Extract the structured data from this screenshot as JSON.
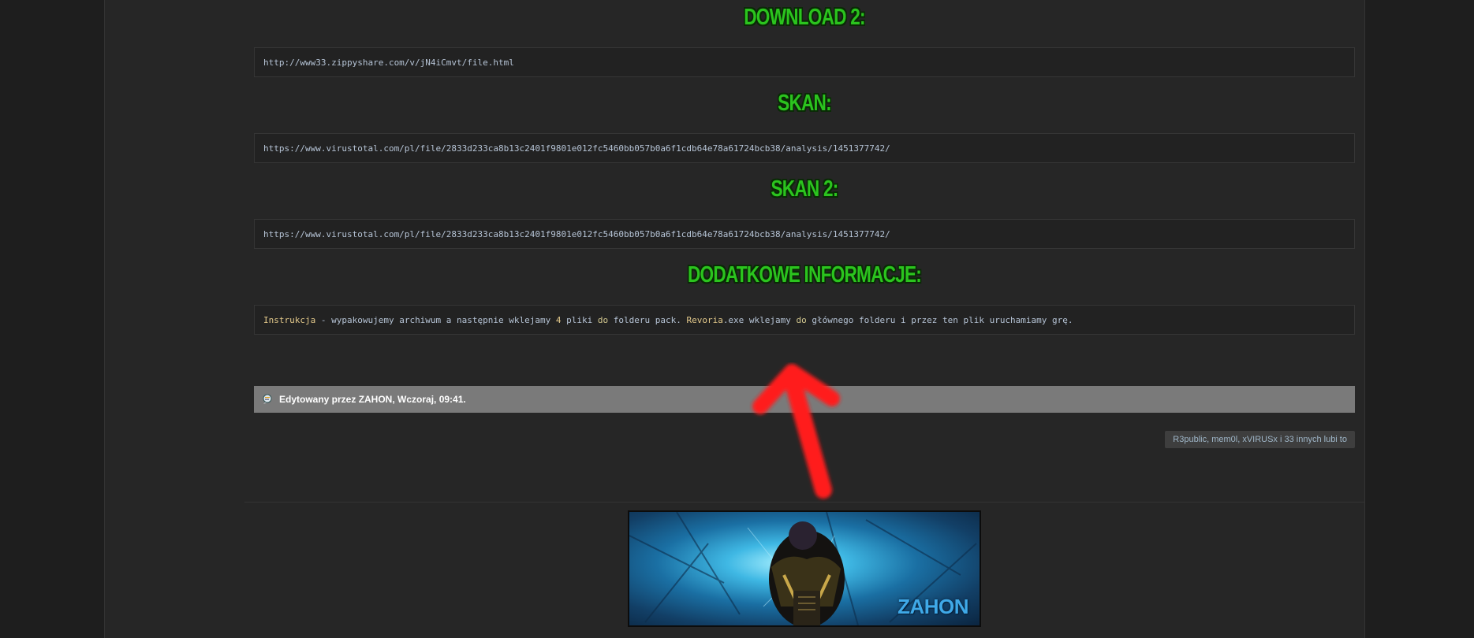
{
  "post": {
    "download2": {
      "heading": "DOWNLOAD 2:",
      "code": "http://www33.zippyshare.com/v/jN4iCmvt/file.html"
    },
    "scan": {
      "heading": "SKAN:",
      "code": "https://www.virustotal.com/pl/file/2833d233ca8b13c2401f9801e012fc5460bb057b0a6f1cdb64e78a61724bcb38/analysis/1451377742/"
    },
    "scan2": {
      "heading": "SKAN 2:",
      "code": "https://www.virustotal.com/pl/file/2833d233ca8b13c2401f9801e012fc5460bb057b0a6f1cdb64e78a61724bcb38/analysis/1451377742/"
    },
    "info": {
      "heading": "DODATKOWE INFORMACJE:",
      "code_parts": {
        "p1": "Instrukcja",
        "p2": " - wypakowujemy archiwum a następnie wklejamy ",
        "p3": "4",
        "p4": " pliki ",
        "p5": "do",
        "p6": " folderu pack. ",
        "p7": "Revoria",
        "p8": ".exe wklejamy ",
        "p9": "do",
        "p10": " głównego folderu i przez ten plik uruchamiamy grę."
      }
    },
    "edit_note": "Edytowany przez ZAHON, Wczoraj, 09:41.",
    "likes": "R3public, mem0l, xVIRUSx i 33 innych lubi to",
    "signature": {
      "banner_text": "ZAHON"
    }
  },
  "colors": {
    "heading_green": "#2bc41e",
    "edit_bar": "#7a7a7a",
    "arrow_red": "#ff1a1a"
  }
}
